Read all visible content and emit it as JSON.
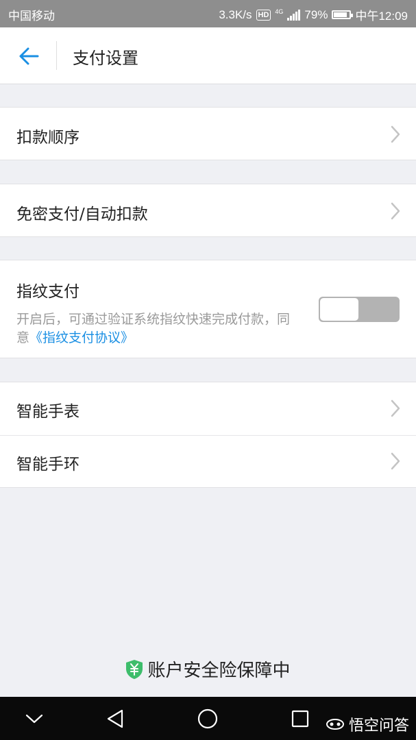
{
  "status_bar": {
    "carrier": "中国移动",
    "speed": "3.3K/s",
    "hd": "HD",
    "network": "4G",
    "battery": "79%",
    "battery_level": 0.79,
    "time": "中午12:09"
  },
  "header": {
    "title": "支付设置",
    "back_icon": "arrow-left-icon"
  },
  "sections": {
    "deduction_order": {
      "label": "扣款顺序"
    },
    "password_free": {
      "label": "免密支付/自动扣款"
    },
    "fingerprint": {
      "label": "指纹支付",
      "desc_prefix": "开启后，可通过验证系统指纹快速完成付款，同意",
      "desc_link": "《指纹支付协议》",
      "toggle_on": false
    },
    "smart_watch": {
      "label": "智能手表"
    },
    "smart_band": {
      "label": "智能手环"
    }
  },
  "footer": {
    "guarantee": "账户安全险保障中",
    "icon": "shield-yuan-icon"
  },
  "nav_bar": {
    "buttons": [
      "chevron-down-icon",
      "back-triangle-icon",
      "home-circle-icon",
      "recents-square-icon"
    ],
    "watermark": "悟空问答"
  },
  "colors": {
    "accent_blue": "#1a8fe3",
    "shield_green": "#3dbd6b",
    "background": "#eff0f4"
  }
}
